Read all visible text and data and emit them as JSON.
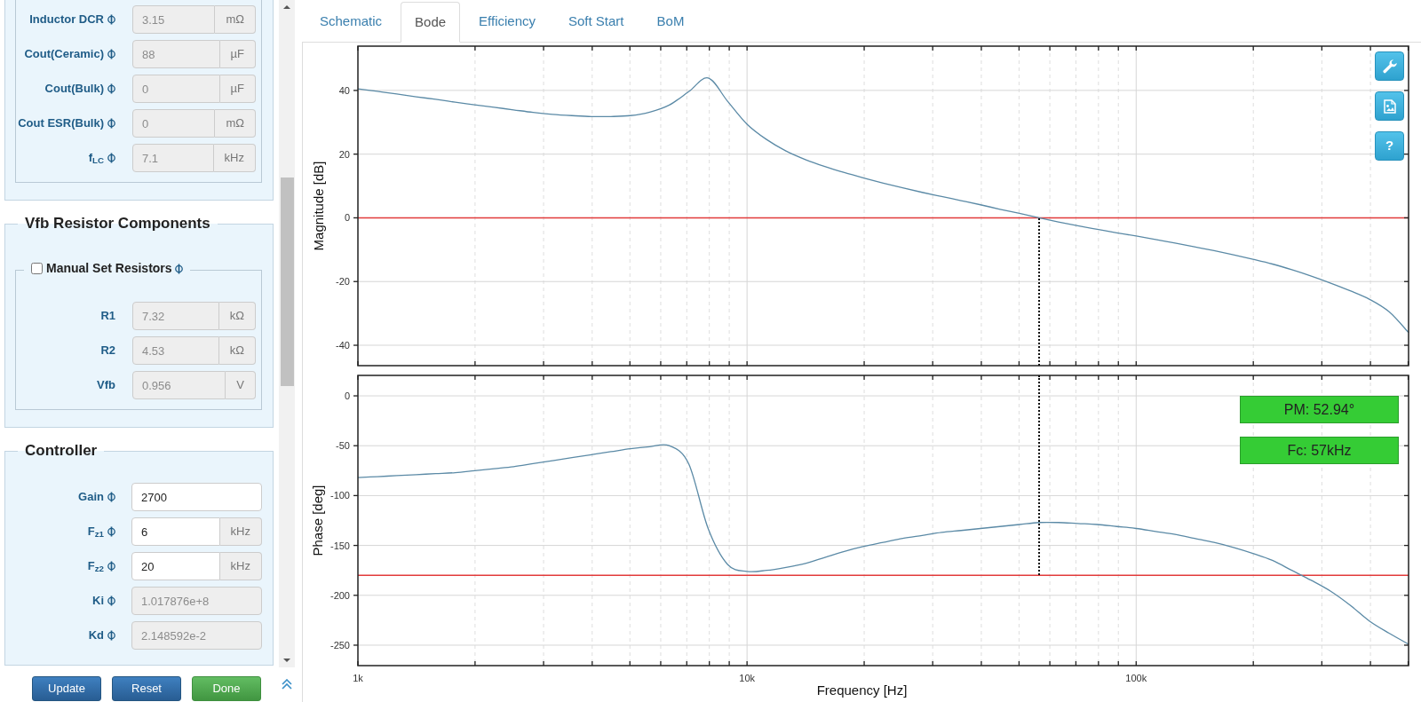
{
  "sidebar": {
    "sections": [
      {
        "group": {
          "rows": [
            {
              "label": "Inductor DCR",
              "info": true,
              "value": "3.15",
              "unit": "mΩ",
              "readonly": true
            },
            {
              "label": "Cout(Ceramic)",
              "info": true,
              "value": "88",
              "unit": "µF",
              "readonly": true
            },
            {
              "label": "Cout(Bulk)",
              "info": true,
              "value": "0",
              "unit": "µF",
              "readonly": true
            },
            {
              "label": "Cout ESR(Bulk)",
              "info": true,
              "value": "0",
              "unit": "mΩ",
              "readonly": true
            },
            {
              "label": "f$_{LC}$",
              "info": true,
              "value": "7.1",
              "unit": "kHz",
              "readonly": true
            }
          ]
        }
      },
      {
        "title": "Vfb Resistor Components",
        "group": {
          "checkbox": {
            "label": "Manual Set Resistors",
            "info": true,
            "checked": false
          },
          "rows": [
            {
              "label": "R1",
              "info": false,
              "value": "7.32",
              "unit": "kΩ",
              "readonly": true
            },
            {
              "label": "R2",
              "info": false,
              "value": "4.53",
              "unit": "kΩ",
              "readonly": true
            },
            {
              "label": "Vfb",
              "info": false,
              "value": "0.956",
              "unit": "V",
              "readonly": true
            }
          ]
        }
      },
      {
        "title": "Controller",
        "rows": [
          {
            "label": "Gain",
            "info": true,
            "value": "2700",
            "readonly": false
          },
          {
            "label": "F$_{z1}$",
            "info": true,
            "value": "6",
            "unit": "kHz",
            "readonly": false
          },
          {
            "label": "F$_{z2}$",
            "info": true,
            "value": "20",
            "unit": "kHz",
            "readonly": false
          },
          {
            "label": "Ki",
            "info": true,
            "value": "1.017876e+8",
            "readonly": true
          },
          {
            "label": "Kd",
            "info": true,
            "value": "2.148592e-2",
            "readonly": true
          }
        ]
      }
    ],
    "buttons": [
      {
        "label": "Update",
        "kind": "primary"
      },
      {
        "label": "Reset",
        "kind": "primary"
      },
      {
        "label": "Done",
        "kind": "success"
      }
    ]
  },
  "tabs": [
    {
      "label": "Schematic",
      "selected": false
    },
    {
      "label": "Bode",
      "selected": true
    },
    {
      "label": "Efficiency",
      "selected": false
    },
    {
      "label": "Soft Start",
      "selected": false
    },
    {
      "label": "BoM",
      "selected": false
    }
  ],
  "bode": {
    "tools": [
      {
        "kind": "settings"
      },
      {
        "kind": "export"
      },
      {
        "kind": "help",
        "label": "?"
      }
    ],
    "magnitude_plot": {
      "chart_data": {
        "type": "line",
        "ylabel": "Magnitude [dB]",
        "categories": [
          null,
          null,
          null,
          null,
          null,
          null,
          null,
          null,
          null,
          null,
          null,
          null,
          null,
          null,
          null,
          null,
          null,
          null,
          null,
          null,
          null,
          null,
          null,
          null,
          null,
          null,
          null,
          null,
          null,
          null,
          null,
          null,
          null,
          null,
          null,
          null,
          null,
          null,
          null,
          null,
          null,
          null,
          null,
          null,
          null,
          null,
          null,
          null,
          null,
          null,
          null,
          null,
          null,
          null,
          null
        ],
        "series": [
          {
            "color": "#5b8aa6",
            "values": [
              40.5,
              39.7,
              38.9,
              38.0,
              37.2,
              36.3,
              35.5,
              34.7,
              33.9,
              33.1,
              32.5,
              32.1,
              31.8,
              31.8,
              32.1,
              33.2,
              35.4,
              39.6,
              43.9,
              36.6,
              29.4,
              24.6,
              21.0,
              18.3,
              16.1,
              14.2,
              12.5,
              10.9,
              9.4,
              8.0,
              6.7,
              5.4,
              4.1,
              2.7,
              1.4,
              0,
              -1.3,
              -2.5,
              -3.6,
              -4.7,
              -5.7,
              -6.8,
              -7.9,
              -9.1,
              -10.3,
              -11.6,
              -13.0,
              -14.5,
              -16.3,
              -18.3,
              -20.5,
              -22.9,
              -25.6,
              -29.5,
              -36.0
            ]
          }
        ],
        "ylim": [
          -46.4,
          53.9
        ],
        "yticks": [
          -40,
          -20,
          0,
          20,
          40
        ],
        "grid": true,
        "ref_lines": [
          {
            "axis": "y",
            "value": 0,
            "color": "#e23b3b"
          }
        ]
      }
    },
    "phase_plot": {
      "chart_data": {
        "type": "line",
        "xlabel": "Frequency [Hz]",
        "ylabel": "Phase [deg]",
        "categories": [
          "1k",
          null,
          null,
          null,
          null,
          null,
          null,
          null,
          null,
          null,
          null,
          null,
          null,
          null,
          null,
          null,
          null,
          null,
          null,
          null,
          "10k",
          null,
          null,
          null,
          null,
          null,
          null,
          null,
          null,
          null,
          null,
          null,
          null,
          null,
          null,
          null,
          null,
          null,
          null,
          null,
          "100k",
          null,
          null,
          null,
          null,
          null,
          null,
          null,
          null,
          null,
          null,
          null,
          null,
          null,
          null
        ],
        "series": [
          {
            "color": "#5b8aa6",
            "values": [
              -82,
              -81,
              -80,
              -79,
              -78,
              -77,
              -75,
              -73,
              -71,
              -68,
              -65,
              -62,
              -59,
              -56,
              -53,
              -51,
              -50,
              -68,
              -133,
              -169,
              -176,
              -175,
              -172,
              -168,
              -162,
              -156,
              -151,
              -147,
              -143,
              -140,
              -137,
              -135,
              -133,
              -131,
              -129,
              -127,
              -127,
              -128,
              -129,
              -131,
              -133,
              -136,
              -139,
              -143,
              -147,
              -152,
              -158,
              -165,
              -175,
              -185,
              -196,
              -210,
              -226,
              -238,
              -249
            ]
          }
        ],
        "ylim": [
          -270.5,
          20.5
        ],
        "yticks": [
          -250,
          -200,
          -150,
          -100,
          -50,
          0
        ],
        "grid": true,
        "ref_lines": [
          {
            "axis": "y",
            "value": -180,
            "color": "#e23b3b"
          }
        ]
      },
      "readouts": [
        "PM: 52.94°",
        "Fc: 57kHz"
      ]
    }
  }
}
